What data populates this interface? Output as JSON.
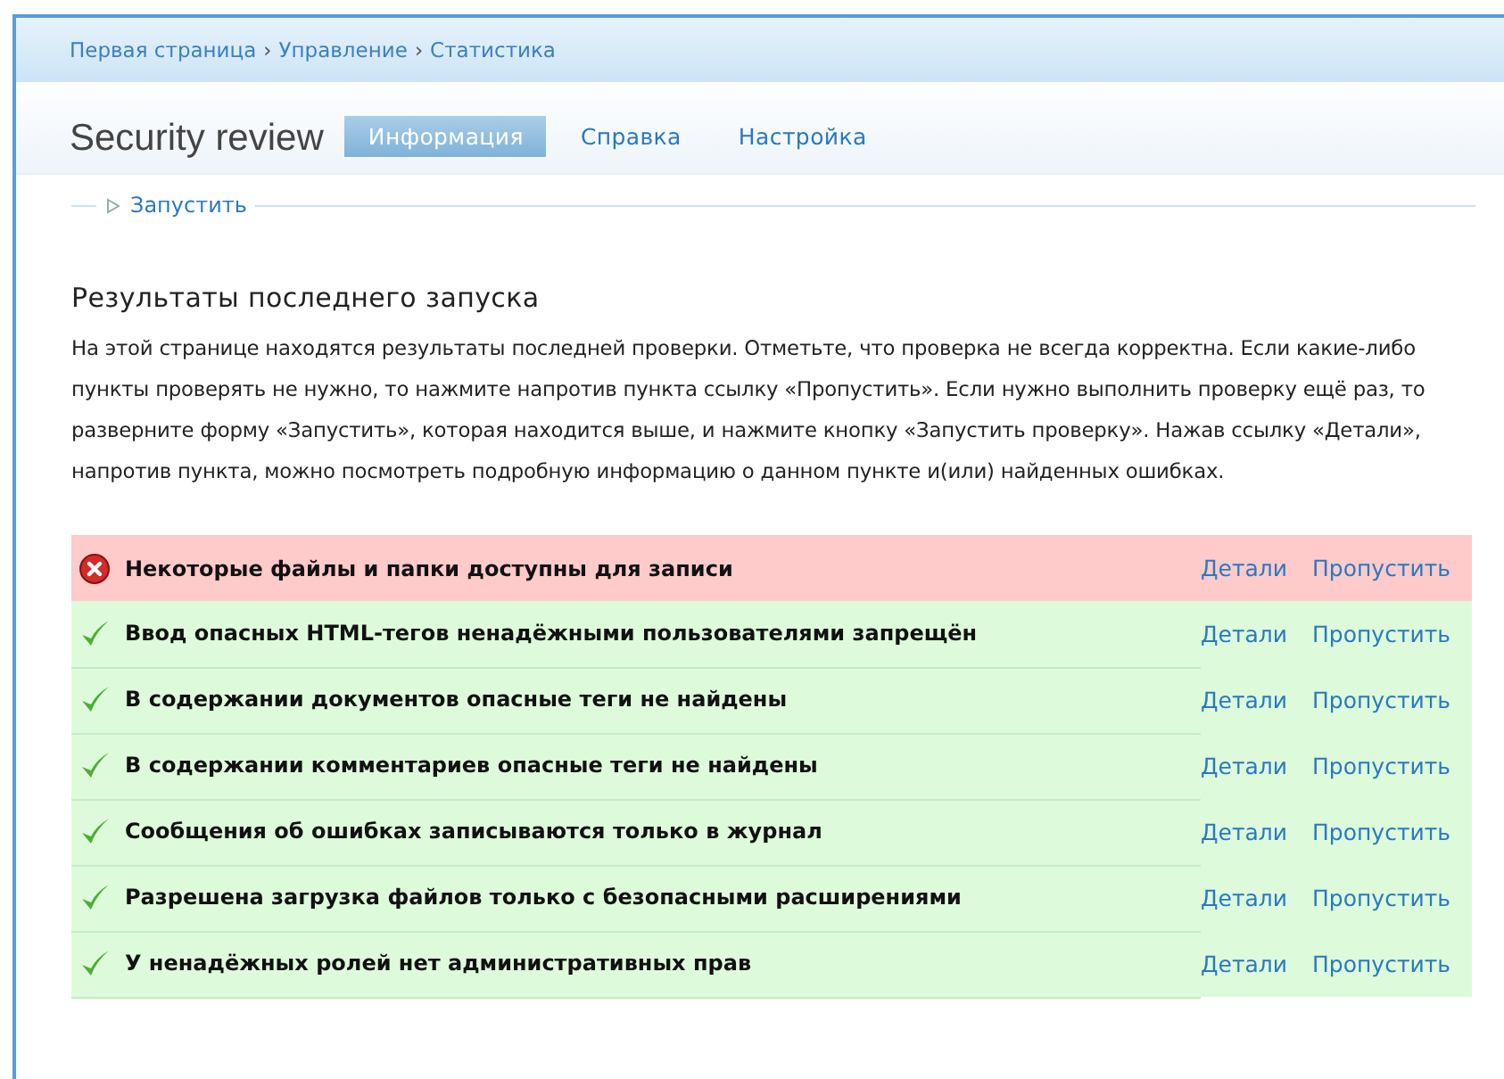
{
  "breadcrumb": [
    "Первая страница",
    "Управление",
    "Статистика"
  ],
  "breadcrumb_separator": "›",
  "title": "Security review",
  "tabs": [
    {
      "label": "Информация",
      "selected": true
    },
    {
      "label": "Справка",
      "selected": false
    },
    {
      "label": "Настройка",
      "selected": false
    }
  ],
  "run_section": {
    "label": "Запустить",
    "expanded": false
  },
  "heading": "Результаты последнего запуска",
  "description": "На этой странице находятся результаты последней проверки. Отметьте, что проверка не всегда корректна. Если какие-либо пункты проверять не нужно, то нажмите напротив пункта ссылку «Пропустить». Если нужно выполнить проверку ещё раз, то разверните форму «Запустить», которая находится выше, и нажмите кнопку «Запустить проверку». Нажав ссылку «Детали», напротив пункта, можно посмотреть подробную информацию о данном пункте и(или) найденных ошибках.",
  "results": [
    {
      "kind": "error",
      "text": "Некоторые файлы и папки доступны для записи",
      "details": "Детали",
      "skip": "Пропустить"
    },
    {
      "kind": "ok",
      "text": "Ввод опасных HTML-тегов ненадёжными пользователями запрещён",
      "details": "Детали",
      "skip": "Пропустить"
    },
    {
      "kind": "ok",
      "text": "В содержании документов опасные теги не найдены",
      "details": "Детали",
      "skip": "Пропустить"
    },
    {
      "kind": "ok",
      "text": "В содержании комментариев опасные теги не найдены",
      "details": "Детали",
      "skip": "Пропустить"
    },
    {
      "kind": "ok",
      "text": "Сообщения об ошибках записываются только в журнал",
      "details": "Детали",
      "skip": "Пропустить"
    },
    {
      "kind": "ok",
      "text": "Разрешена загрузка файлов только с безопасными расширениями",
      "details": "Детали",
      "skip": "Пропустить"
    },
    {
      "kind": "ok",
      "text": "У ненадёжных ролей нет административных прав",
      "details": "Детали",
      "skip": "Пропустить"
    }
  ]
}
